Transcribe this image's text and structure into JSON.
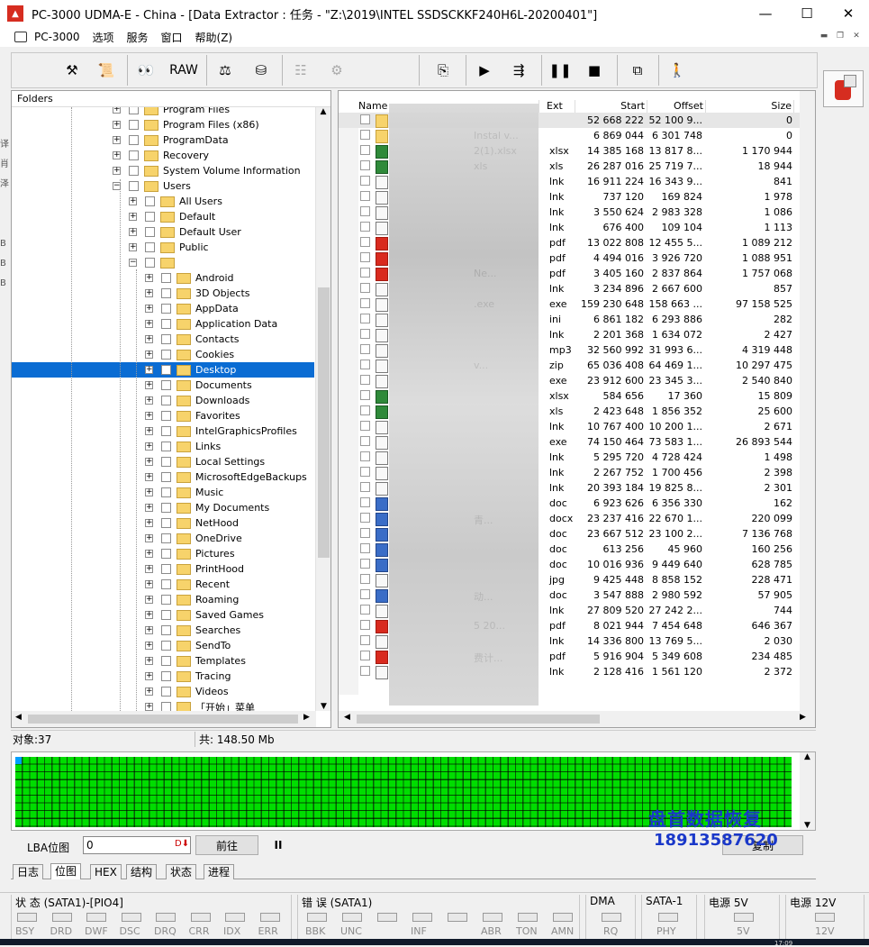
{
  "title": "PC-3000 UDMA-E - China - [Data Extractor : 任务 - \"Z:\\2019\\INTEL SSDSCKKF240H6L-20200401\"]",
  "menu": [
    "PC-3000",
    "选项",
    "服务",
    "窗口",
    "帮助(Z)"
  ],
  "toolbar": {
    "raw_label": "RAW"
  },
  "edge_chars": [
    "译",
    "肖",
    "泽",
    "B",
    "B",
    "B"
  ],
  "folders": {
    "header": "Folders",
    "items": [
      {
        "label": "Program Files",
        "level": 0
      },
      {
        "label": "Program Files (x86)",
        "level": 0
      },
      {
        "label": "ProgramData",
        "level": 0
      },
      {
        "label": "Recovery",
        "level": 0
      },
      {
        "label": "System Volume Information",
        "level": 0
      },
      {
        "label": "Users",
        "level": 0
      },
      {
        "label": "All Users",
        "level": 1
      },
      {
        "label": "Default",
        "level": 1
      },
      {
        "label": "Default User",
        "level": 1
      },
      {
        "label": "Public",
        "level": 1
      },
      {
        "label": "",
        "level": 1
      },
      {
        "label": "Android",
        "level": 2
      },
      {
        "label": "3D Objects",
        "level": 2
      },
      {
        "label": "AppData",
        "level": 2
      },
      {
        "label": "Application Data",
        "level": 2
      },
      {
        "label": "Contacts",
        "level": 2
      },
      {
        "label": "Cookies",
        "level": 2
      },
      {
        "label": "Desktop",
        "level": 2
      },
      {
        "label": "Documents",
        "level": 2
      },
      {
        "label": "Downloads",
        "level": 2
      },
      {
        "label": "Favorites",
        "level": 2
      },
      {
        "label": "IntelGraphicsProfiles",
        "level": 2
      },
      {
        "label": "Links",
        "level": 2
      },
      {
        "label": "Local Settings",
        "level": 2
      },
      {
        "label": "MicrosoftEdgeBackups",
        "level": 2
      },
      {
        "label": "Music",
        "level": 2
      },
      {
        "label": "My Documents",
        "level": 2
      },
      {
        "label": "NetHood",
        "level": 2
      },
      {
        "label": "OneDrive",
        "level": 2
      },
      {
        "label": "Pictures",
        "level": 2
      },
      {
        "label": "PrintHood",
        "level": 2
      },
      {
        "label": "Recent",
        "level": 2
      },
      {
        "label": "Roaming",
        "level": 2
      },
      {
        "label": "Saved Games",
        "level": 2
      },
      {
        "label": "Searches",
        "level": 2
      },
      {
        "label": "SendTo",
        "level": 2
      },
      {
        "label": "Templates",
        "level": 2
      },
      {
        "label": "Tracing",
        "level": 2
      },
      {
        "label": "Videos",
        "level": 2
      },
      {
        "label": "「开始」菜单",
        "level": 2
      }
    ],
    "selected": "Desktop"
  },
  "files": {
    "columns": [
      "Name",
      "Ext",
      "Start",
      "Offset",
      "Size"
    ],
    "rows": [
      {
        "name": "",
        "icon": "folder",
        "ext": "",
        "start": "52 668 222",
        "offset": "52 100 9...",
        "size": "0"
      },
      {
        "name": "Instal v...",
        "icon": "folder",
        "ext": "",
        "start": "6 869 044",
        "offset": "6 301 748",
        "size": "0"
      },
      {
        "name": "2(1).xlsx",
        "icon": "xls",
        "ext": "xlsx",
        "start": "14 385 168",
        "offset": "13 817 8...",
        "size": "1 170 944"
      },
      {
        "name": "xls",
        "icon": "xls",
        "ext": "xls",
        "start": "26 287 016",
        "offset": "25 719 7...",
        "size": "18 944"
      },
      {
        "name": "",
        "icon": "file",
        "ext": "lnk",
        "start": "16 911 224",
        "offset": "16 343 9...",
        "size": "841"
      },
      {
        "name": "",
        "icon": "file",
        "ext": "lnk",
        "start": "737 120",
        "offset": "169 824",
        "size": "1 978"
      },
      {
        "name": "",
        "icon": "file",
        "ext": "lnk",
        "start": "3 550 624",
        "offset": "2 983 328",
        "size": "1 086"
      },
      {
        "name": "",
        "icon": "file",
        "ext": "lnk",
        "start": "676 400",
        "offset": "109 104",
        "size": "1 113"
      },
      {
        "name": "",
        "icon": "pdf",
        "ext": "pdf",
        "start": "13 022 808",
        "offset": "12 455 5...",
        "size": "1 089 212"
      },
      {
        "name": "",
        "icon": "pdf",
        "ext": "pdf",
        "start": "4 494 016",
        "offset": "3 926 720",
        "size": "1 088 951"
      },
      {
        "name": "Ne...",
        "icon": "pdf",
        "ext": "pdf",
        "start": "3 405 160",
        "offset": "2 837 864",
        "size": "1 757 068"
      },
      {
        "name": "",
        "icon": "file",
        "ext": "lnk",
        "start": "3 234 896",
        "offset": "2 667 600",
        "size": "857"
      },
      {
        "name": ".exe",
        "icon": "file",
        "ext": "exe",
        "start": "159 230 648",
        "offset": "158 663 ...",
        "size": "97 158 525"
      },
      {
        "name": "",
        "icon": "file",
        "ext": "ini",
        "start": "6 861 182",
        "offset": "6 293 886",
        "size": "282"
      },
      {
        "name": "",
        "icon": "file",
        "ext": "lnk",
        "start": "2 201 368",
        "offset": "1 634 072",
        "size": "2 427"
      },
      {
        "name": "",
        "icon": "file",
        "ext": "mp3",
        "start": "32 560 992",
        "offset": "31 993 6...",
        "size": "4 319 448"
      },
      {
        "name": "v...",
        "icon": "file",
        "ext": "zip",
        "start": "65 036 408",
        "offset": "64 469 1...",
        "size": "10 297 475"
      },
      {
        "name": "",
        "icon": "file",
        "ext": "exe",
        "start": "23 912 600",
        "offset": "23 345 3...",
        "size": "2 540 840"
      },
      {
        "name": "",
        "icon": "xls",
        "ext": "xlsx",
        "start": "584 656",
        "offset": "17 360",
        "size": "15 809"
      },
      {
        "name": "",
        "icon": "xls",
        "ext": "xls",
        "start": "2 423 648",
        "offset": "1 856 352",
        "size": "25 600"
      },
      {
        "name": "",
        "icon": "file",
        "ext": "lnk",
        "start": "10 767 400",
        "offset": "10 200 1...",
        "size": "2 671"
      },
      {
        "name": "",
        "icon": "file",
        "ext": "exe",
        "start": "74 150 464",
        "offset": "73 583 1...",
        "size": "26 893 544"
      },
      {
        "name": "",
        "icon": "file",
        "ext": "lnk",
        "start": "5 295 720",
        "offset": "4 728 424",
        "size": "1 498"
      },
      {
        "name": "",
        "icon": "file",
        "ext": "lnk",
        "start": "2 267 752",
        "offset": "1 700 456",
        "size": "2 398"
      },
      {
        "name": "",
        "icon": "file",
        "ext": "lnk",
        "start": "20 393 184",
        "offset": "19 825 8...",
        "size": "2 301"
      },
      {
        "name": "",
        "icon": "doc",
        "ext": "doc",
        "start": "6 923 626",
        "offset": "6 356 330",
        "size": "162"
      },
      {
        "name": "青...",
        "icon": "doc",
        "ext": "docx",
        "start": "23 237 416",
        "offset": "22 670 1...",
        "size": "220 099"
      },
      {
        "name": "",
        "icon": "doc",
        "ext": "doc",
        "start": "23 667 512",
        "offset": "23 100 2...",
        "size": "7 136 768"
      },
      {
        "name": "",
        "icon": "doc",
        "ext": "doc",
        "start": "613 256",
        "offset": "45 960",
        "size": "160 256"
      },
      {
        "name": "",
        "icon": "doc",
        "ext": "doc",
        "start": "10 016 936",
        "offset": "9 449 640",
        "size": "628 785"
      },
      {
        "name": "",
        "icon": "file",
        "ext": "jpg",
        "start": "9 425 448",
        "offset": "8 858 152",
        "size": "228 471"
      },
      {
        "name": "动...",
        "icon": "doc",
        "ext": "doc",
        "start": "3 547 888",
        "offset": "2 980 592",
        "size": "57 905"
      },
      {
        "name": "",
        "icon": "file",
        "ext": "lnk",
        "start": "27 809 520",
        "offset": "27 242 2...",
        "size": "744"
      },
      {
        "name": "5 20...",
        "icon": "pdf",
        "ext": "pdf",
        "start": "8 021 944",
        "offset": "7 454 648",
        "size": "646 367"
      },
      {
        "name": "",
        "icon": "file",
        "ext": "lnk",
        "start": "14 336 800",
        "offset": "13 769 5...",
        "size": "2 030"
      },
      {
        "name": "费计...",
        "icon": "pdf",
        "ext": "pdf",
        "start": "5 916 904",
        "offset": "5 349 608",
        "size": "234 485"
      },
      {
        "name": "",
        "icon": "file",
        "ext": "lnk",
        "start": "2 128 416",
        "offset": "1 561 120",
        "size": "2 372"
      }
    ]
  },
  "status": {
    "objects": "对象:37",
    "total": "共: 148.50 Mb"
  },
  "lba": {
    "label": "LBA位图",
    "value": "0",
    "forward": "前往",
    "pause": "II",
    "second_btn": "复制"
  },
  "watermark": {
    "line1": "盘首数据恢复",
    "line2": "18913587620"
  },
  "tabs": [
    "日志",
    "位图",
    "HEX",
    "结构",
    "状态",
    "进程"
  ],
  "active_tab": "位图",
  "indicators": {
    "status_group": {
      "title": "状 态 (SATA1)-[PIO4]",
      "leds": [
        "BSY",
        "DRD",
        "DWF",
        "DSC",
        "DRQ",
        "CRR",
        "IDX",
        "ERR"
      ]
    },
    "error_group": {
      "title": "错 误 (SATA1)",
      "leds": [
        "BBK",
        "UNC",
        "",
        "INF",
        "",
        "ABR",
        "TON",
        "AMN"
      ]
    },
    "dma_group": {
      "title": "DMA",
      "leds": [
        "RQ"
      ]
    },
    "sata_group": {
      "title": "SATA-1",
      "leds": [
        "PHY"
      ]
    },
    "p5_group": {
      "title": "电源 5V",
      "leds": [
        "5V"
      ]
    },
    "p12_group": {
      "title": "电源 12V",
      "leds": [
        "12V"
      ]
    }
  },
  "clock": "17:09",
  "colors": {
    "accent_blue": "#0a6cd3",
    "map_green": "#00dd00",
    "pdf_red": "#d92a1e",
    "watermark": "#1a38c9"
  }
}
